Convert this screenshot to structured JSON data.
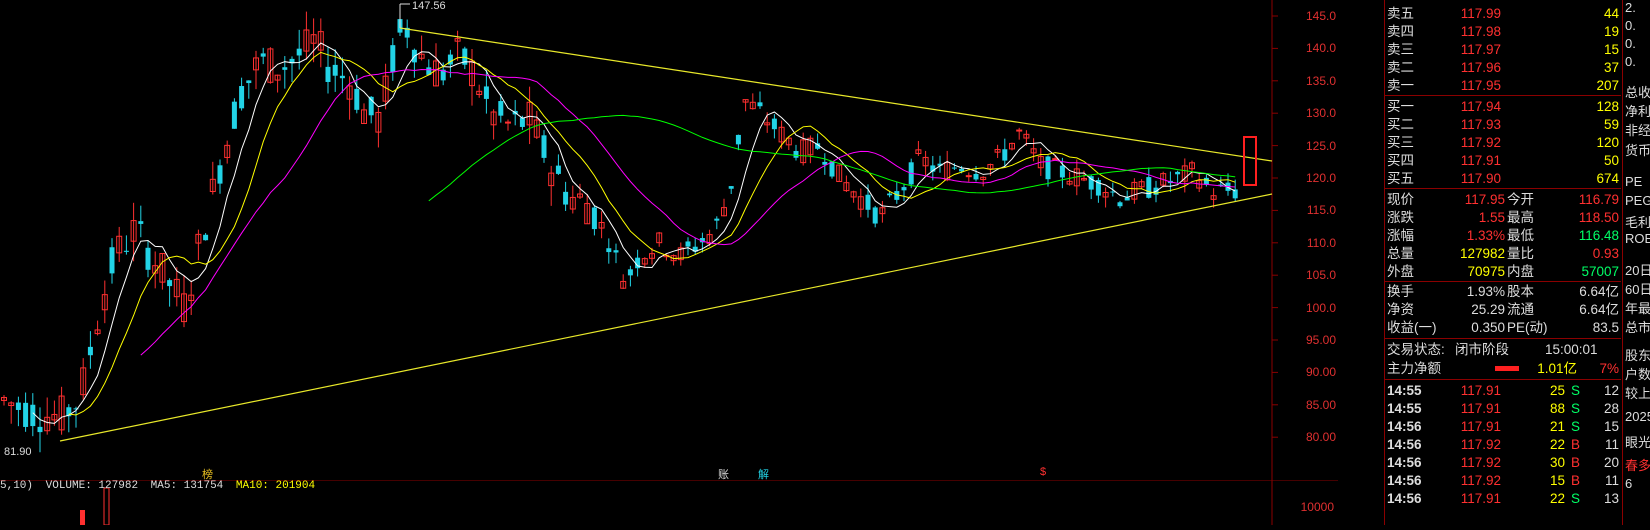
{
  "chart": {
    "y_axis_ticks": [
      "145.0",
      "140.0",
      "135.0",
      "130.0",
      "125.0",
      "120.0",
      "115.0",
      "110.0",
      "105.0",
      "100.0",
      "95.00",
      "90.00",
      "85.00",
      "80.00"
    ],
    "vol_axis_tick": "10000",
    "high_label": "147.56",
    "low_label": "81.90",
    "markers": [
      "榜",
      "账",
      "解",
      "$"
    ],
    "volume_header": {
      "prefix": "5,10)",
      "volume": "VOLUME: 127982",
      "ma5": "MA5: 131754",
      "ma10": "MA10: 201904"
    },
    "colors": {
      "up": "#ff3030",
      "down": "#22d3e6",
      "ma5": "#ffffff",
      "ma10": "#ffff00",
      "ma20": "#ff00ff",
      "ma60": "#00ff00",
      "trend": "#e8e82a"
    }
  },
  "chart_data": {
    "type": "candlestick",
    "ylim": [
      78,
      147.56
    ],
    "high": 147.56,
    "low": 81.9
  },
  "orderbook": {
    "asks": [
      {
        "label": "卖五",
        "price": "117.99",
        "vol": "44"
      },
      {
        "label": "卖四",
        "price": "117.98",
        "vol": "19"
      },
      {
        "label": "卖三",
        "price": "117.97",
        "vol": "15"
      },
      {
        "label": "卖二",
        "price": "117.96",
        "vol": "37"
      },
      {
        "label": "卖一",
        "price": "117.95",
        "vol": "207"
      }
    ],
    "bids": [
      {
        "label": "买一",
        "price": "117.94",
        "vol": "128"
      },
      {
        "label": "买二",
        "price": "117.93",
        "vol": "59"
      },
      {
        "label": "买三",
        "price": "117.92",
        "vol": "120"
      },
      {
        "label": "买四",
        "price": "117.91",
        "vol": "50"
      },
      {
        "label": "买五",
        "price": "117.90",
        "vol": "674"
      }
    ]
  },
  "quote": [
    {
      "l1": "现价",
      "v1": "117.95",
      "l2": "今开",
      "v2": "116.79"
    },
    {
      "l1": "涨跌",
      "v1": "1.55",
      "l2": "最高",
      "v2": "118.50"
    },
    {
      "l1": "涨幅",
      "v1": "1.33%",
      "l2": "最低",
      "v2": "116.48"
    },
    {
      "l1": "总量",
      "v1": "127982",
      "l2": "量比",
      "v2": "0.93"
    },
    {
      "l1": "外盘",
      "v1": "70975",
      "l2": "内盘",
      "v2": "57007"
    },
    {
      "l1": "换手",
      "v1": "1.93%",
      "l2": "股本",
      "v2": "6.64亿"
    },
    {
      "l1": "净资",
      "v1": "25.29",
      "l2": "流通",
      "v2": "6.64亿"
    },
    {
      "l1": "收益(一)",
      "v1": "0.350",
      "l2": "PE(动)",
      "v2": "83.5"
    }
  ],
  "status": {
    "label": "交易状态:",
    "value": "闭市阶段",
    "time": "15:00:01"
  },
  "mainflow": {
    "label": "主力净额",
    "value": "1.01亿",
    "pct": "7%"
  },
  "ticks": [
    {
      "time": "14:55",
      "price": "117.91",
      "vol": "25",
      "side": "S",
      "n": "12"
    },
    {
      "time": "14:55",
      "price": "117.91",
      "vol": "88",
      "side": "S",
      "n": "28"
    },
    {
      "time": "14:56",
      "price": "117.91",
      "vol": "21",
      "side": "S",
      "n": "15"
    },
    {
      "time": "14:56",
      "price": "117.92",
      "vol": "22",
      "side": "B",
      "n": "11"
    },
    {
      "time": "14:56",
      "price": "117.92",
      "vol": "30",
      "side": "B",
      "n": "20"
    },
    {
      "time": "14:56",
      "price": "117.92",
      "vol": "15",
      "side": "B",
      "n": "11"
    },
    {
      "time": "14:56",
      "price": "117.91",
      "vol": "22",
      "side": "S",
      "n": "13"
    }
  ],
  "extra": [
    "2.",
    "0.",
    "0.",
    "0.",
    "总收",
    "净利",
    "非经",
    "货币",
    "PE",
    "PEG",
    "毛利",
    "ROE",
    "20日",
    "60日",
    "年最",
    "总市",
    "股东",
    "户数",
    "较上",
    "2025",
    "眼光",
    "春多",
    "6"
  ]
}
